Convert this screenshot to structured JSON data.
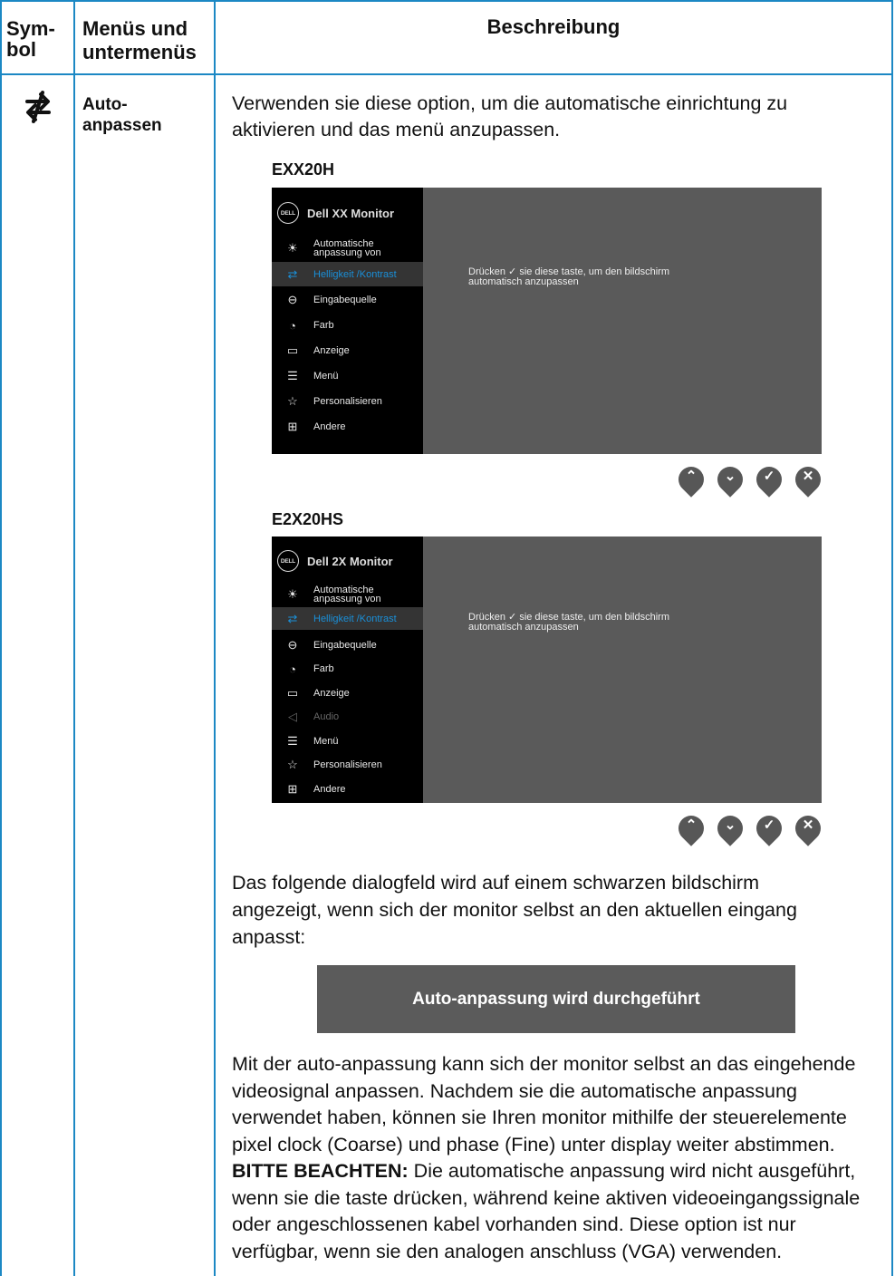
{
  "header": {
    "col_symbol": "Sym-\nbol",
    "col_symbol_line1": "Sym-",
    "col_symbol_line2": "bol",
    "col_menus_line1": "Menüs und",
    "col_menus_line2": "untermenüs",
    "col_desc": "Beschreibung"
  },
  "row": {
    "symbol_icon": "auto-adjust-arrows-icon",
    "menu_line1": "Auto-",
    "menu_line2": "anpassen",
    "intro_line1": "Verwenden sie diese option, um die automatische einrichtung zu",
    "intro_line2": "aktivieren und das menü anzupassen."
  },
  "osd1": {
    "model": "EXX20H",
    "brand_logo": "DELL",
    "title": "Dell XX Monitor",
    "items": [
      {
        "icon": "brightness-icon",
        "line1": "Automatische",
        "line2": "anpassung von"
      },
      {
        "icon": "auto-adjust-icon",
        "line1": "Helligkeit /Kontrast"
      },
      {
        "icon": "input-source-icon",
        "line1": "Eingabequelle"
      },
      {
        "icon": "color-icon",
        "line1": "Farb"
      },
      {
        "icon": "display-icon",
        "line1": "Anzeige"
      },
      {
        "icon": "menu-icon",
        "line1": "Menü"
      },
      {
        "icon": "star-icon",
        "line1": "Personalisieren"
      },
      {
        "icon": "other-icon",
        "line1": "Andere"
      }
    ],
    "msg_pre": "Drücken",
    "msg_post": "sie diese taste, um den bildschirm",
    "msg_line2": "automatisch anzupassen"
  },
  "osd2": {
    "model": "E2X20HS",
    "brand_logo": "DELL",
    "title": "Dell 2X Monitor",
    "items": [
      {
        "icon": "brightness-icon",
        "line1": "Automatische",
        "line2": "anpassung von"
      },
      {
        "icon": "auto-adjust-icon",
        "line1": "Helligkeit /Kontrast"
      },
      {
        "icon": "input-source-icon",
        "line1": "Eingabequelle"
      },
      {
        "icon": "color-icon",
        "line1": "Farb"
      },
      {
        "icon": "display-icon",
        "line1": "Anzeige"
      },
      {
        "icon": "audio-icon",
        "line1": "Audio"
      },
      {
        "icon": "menu-icon",
        "line1": "Menü"
      },
      {
        "icon": "star-icon",
        "line1": "Personalisieren"
      },
      {
        "icon": "other-icon",
        "line1": "Andere"
      }
    ],
    "msg_pre": "Drücken",
    "msg_post": "sie diese taste, um den bildschirm",
    "msg_line2": "automatisch anzupassen"
  },
  "buttons": [
    "up-button",
    "down-button",
    "check-button",
    "close-button"
  ],
  "after_text": {
    "line1": "Das folgende dialogfeld wird auf einem schwarzen bildschirm",
    "line2": "angezeigt, wenn sich der monitor selbst an den aktuellen eingang",
    "line3": "anpasst:"
  },
  "dialog_text": "Auto-anpassung wird durchgeführt",
  "final_text": {
    "line1": "Mit der auto-anpassung kann sich der monitor selbst an das eingehende",
    "line2": "videosignal anpassen. Nachdem sie die automatische anpassung",
    "line3": "verwendet haben, können sie Ihren monitor mithilfe der steuerelemente",
    "line4": "pixel clock (Coarse) und phase (Fine) unter display weiter abstimmen.",
    "note_label": "BITTE BEACHTEN:",
    "line5_rest": " Die automatische anpassung wird nicht ausgeführt,",
    "line6": "wenn sie die taste drücken, während keine aktiven videoeingangssignale",
    "line7": "oder angeschlossenen kabel vorhanden sind. Diese option ist nur",
    "line8": "verfügbar, wenn sie den analogen anschluss (VGA) verwenden."
  },
  "colors": {
    "border": "#1c88c4",
    "osd_panel": "#5a5a5a",
    "osd_sidebar": "#000000",
    "osd_selected": "#1a8fd8",
    "dialog_bg": "#5b5b5b"
  }
}
